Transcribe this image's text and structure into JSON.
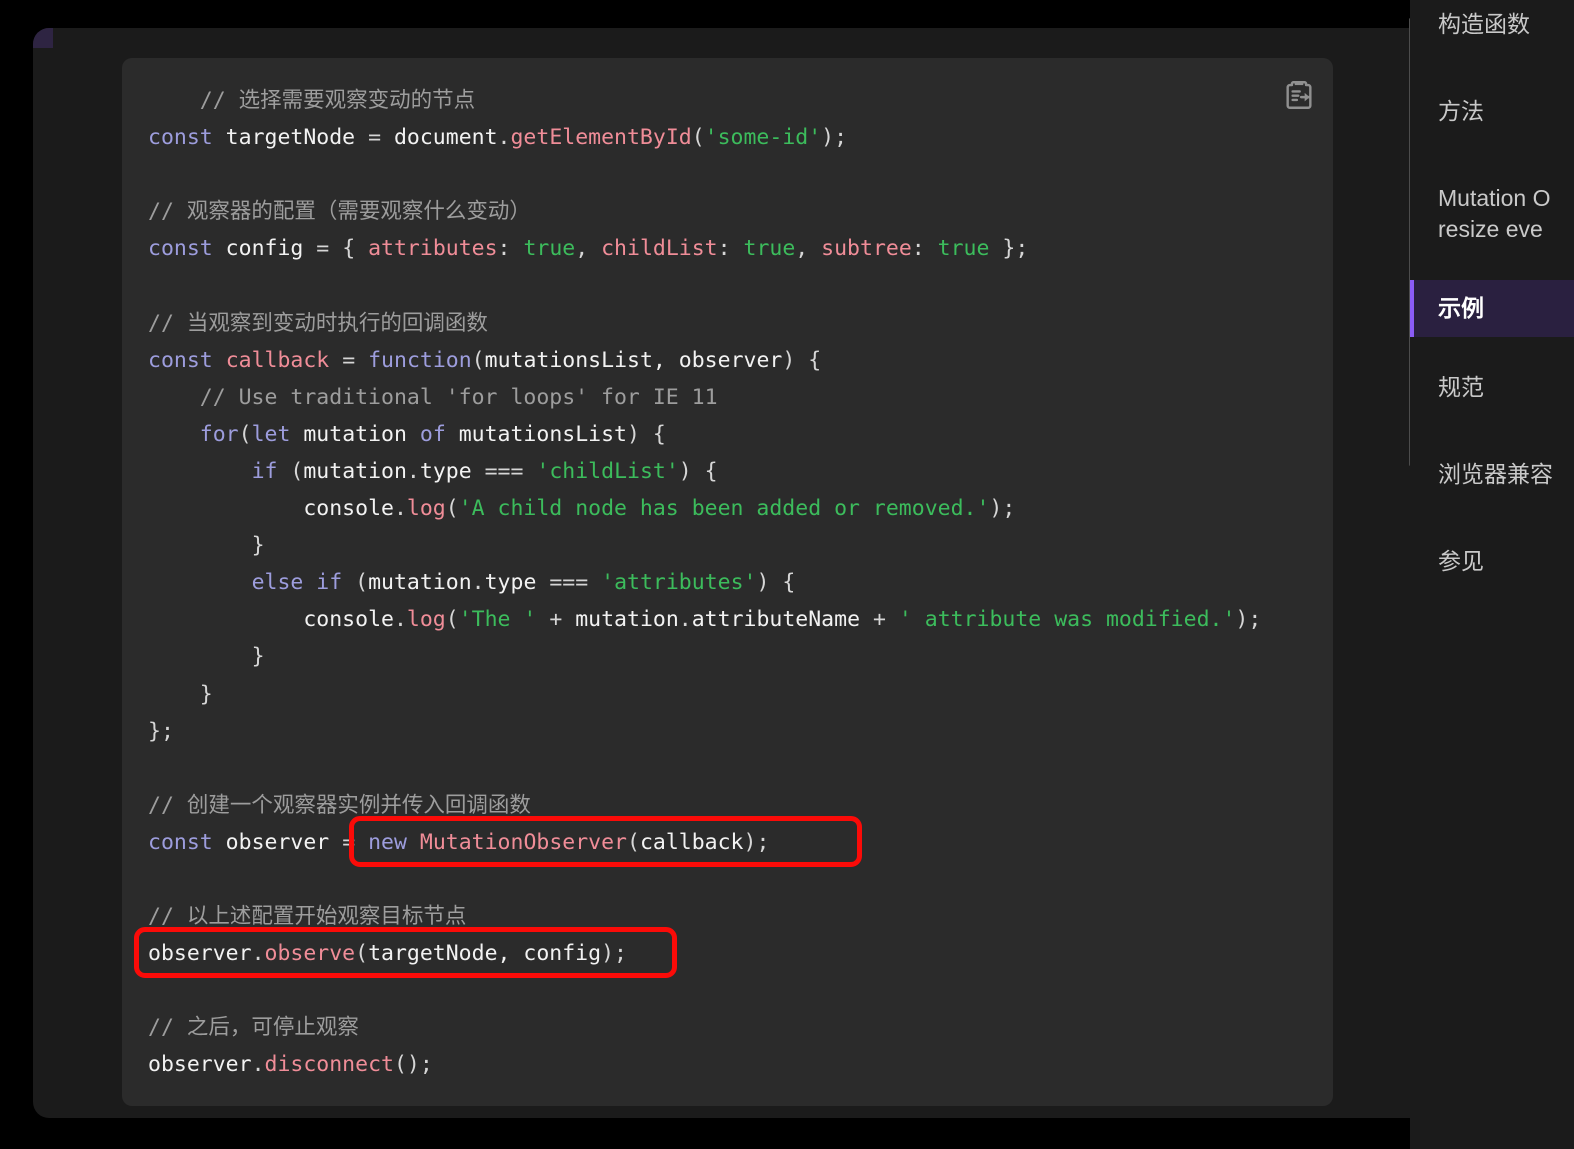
{
  "page": {
    "surface_color": "#1b1b1b",
    "corner_accent_color": "#2e2442"
  },
  "code_block": {
    "language": "javascript",
    "background_color": "#2b2b2b",
    "copy_icon": "clipboard-copy-icon",
    "lines": [
      {
        "indent": 1,
        "tokens": [
          {
            "t": "com",
            "s": "// 选择需要观察变动的节点"
          }
        ]
      },
      {
        "indent": 0,
        "tokens": [
          {
            "t": "kw",
            "s": "const"
          },
          {
            "t": "pln",
            "s": " targetNode "
          },
          {
            "t": "punc",
            "s": "="
          },
          {
            "t": "pln",
            "s": " document"
          },
          {
            "t": "punc",
            "s": "."
          },
          {
            "t": "fn",
            "s": "getElementById"
          },
          {
            "t": "punc",
            "s": "("
          },
          {
            "t": "str",
            "s": "'some-id'"
          },
          {
            "t": "punc",
            "s": ");"
          }
        ]
      },
      {
        "indent": 0,
        "tokens": []
      },
      {
        "indent": 0,
        "tokens": [
          {
            "t": "com",
            "s": "// 观察器的配置（需要观察什么变动）"
          }
        ]
      },
      {
        "indent": 0,
        "tokens": [
          {
            "t": "kw",
            "s": "const"
          },
          {
            "t": "pln",
            "s": " config "
          },
          {
            "t": "punc",
            "s": "="
          },
          {
            "t": "punc",
            "s": " { "
          },
          {
            "t": "fn",
            "s": "attributes"
          },
          {
            "t": "punc",
            "s": ": "
          },
          {
            "t": "num",
            "s": "true"
          },
          {
            "t": "punc",
            "s": ", "
          },
          {
            "t": "fn",
            "s": "childList"
          },
          {
            "t": "punc",
            "s": ": "
          },
          {
            "t": "num",
            "s": "true"
          },
          {
            "t": "punc",
            "s": ", "
          },
          {
            "t": "fn",
            "s": "subtree"
          },
          {
            "t": "punc",
            "s": ": "
          },
          {
            "t": "num",
            "s": "true"
          },
          {
            "t": "punc",
            "s": " };"
          }
        ]
      },
      {
        "indent": 0,
        "tokens": []
      },
      {
        "indent": 0,
        "tokens": [
          {
            "t": "com",
            "s": "// 当观察到变动时执行的回调函数"
          }
        ]
      },
      {
        "indent": 0,
        "tokens": [
          {
            "t": "kw",
            "s": "const"
          },
          {
            "t": "pln",
            "s": " "
          },
          {
            "t": "fn",
            "s": "callback"
          },
          {
            "t": "pln",
            "s": " "
          },
          {
            "t": "punc",
            "s": "="
          },
          {
            "t": "pln",
            "s": " "
          },
          {
            "t": "kw",
            "s": "function"
          },
          {
            "t": "punc",
            "s": "("
          },
          {
            "t": "pln",
            "s": "mutationsList, observer"
          },
          {
            "t": "punc",
            "s": ") {"
          }
        ]
      },
      {
        "indent": 1,
        "tokens": [
          {
            "t": "com",
            "s": "// Use traditional 'for loops' for IE 11"
          }
        ]
      },
      {
        "indent": 1,
        "tokens": [
          {
            "t": "kw",
            "s": "for"
          },
          {
            "t": "punc",
            "s": "("
          },
          {
            "t": "kw",
            "s": "let"
          },
          {
            "t": "pln",
            "s": " mutation "
          },
          {
            "t": "kw",
            "s": "of"
          },
          {
            "t": "pln",
            "s": " mutationsList"
          },
          {
            "t": "punc",
            "s": ") {"
          }
        ]
      },
      {
        "indent": 2,
        "tokens": [
          {
            "t": "kw",
            "s": "if"
          },
          {
            "t": "pln",
            "s": " "
          },
          {
            "t": "punc",
            "s": "("
          },
          {
            "t": "pln",
            "s": "mutation"
          },
          {
            "t": "punc",
            "s": "."
          },
          {
            "t": "pln",
            "s": "type "
          },
          {
            "t": "punc",
            "s": "==="
          },
          {
            "t": "pln",
            "s": " "
          },
          {
            "t": "str",
            "s": "'childList'"
          },
          {
            "t": "punc",
            "s": ") {"
          }
        ]
      },
      {
        "indent": 3,
        "tokens": [
          {
            "t": "pln",
            "s": "console"
          },
          {
            "t": "punc",
            "s": "."
          },
          {
            "t": "fn",
            "s": "log"
          },
          {
            "t": "punc",
            "s": "("
          },
          {
            "t": "str",
            "s": "'A child node has been added or removed.'"
          },
          {
            "t": "punc",
            "s": ");"
          }
        ]
      },
      {
        "indent": 2,
        "tokens": [
          {
            "t": "punc",
            "s": "}"
          }
        ]
      },
      {
        "indent": 2,
        "tokens": [
          {
            "t": "kw",
            "s": "else"
          },
          {
            "t": "pln",
            "s": " "
          },
          {
            "t": "kw",
            "s": "if"
          },
          {
            "t": "pln",
            "s": " "
          },
          {
            "t": "punc",
            "s": "("
          },
          {
            "t": "pln",
            "s": "mutation"
          },
          {
            "t": "punc",
            "s": "."
          },
          {
            "t": "pln",
            "s": "type "
          },
          {
            "t": "punc",
            "s": "==="
          },
          {
            "t": "pln",
            "s": " "
          },
          {
            "t": "str",
            "s": "'attributes'"
          },
          {
            "t": "punc",
            "s": ") {"
          }
        ]
      },
      {
        "indent": 3,
        "tokens": [
          {
            "t": "pln",
            "s": "console"
          },
          {
            "t": "punc",
            "s": "."
          },
          {
            "t": "fn",
            "s": "log"
          },
          {
            "t": "punc",
            "s": "("
          },
          {
            "t": "str",
            "s": "'The '"
          },
          {
            "t": "pln",
            "s": " "
          },
          {
            "t": "punc",
            "s": "+"
          },
          {
            "t": "pln",
            "s": " mutation"
          },
          {
            "t": "punc",
            "s": "."
          },
          {
            "t": "pln",
            "s": "attributeName "
          },
          {
            "t": "punc",
            "s": "+"
          },
          {
            "t": "pln",
            "s": " "
          },
          {
            "t": "str",
            "s": "' attribute was modified.'"
          },
          {
            "t": "punc",
            "s": ");"
          }
        ]
      },
      {
        "indent": 2,
        "tokens": [
          {
            "t": "punc",
            "s": "}"
          }
        ]
      },
      {
        "indent": 1,
        "tokens": [
          {
            "t": "punc",
            "s": "}"
          }
        ]
      },
      {
        "indent": 0,
        "tokens": [
          {
            "t": "punc",
            "s": "};"
          }
        ]
      },
      {
        "indent": 0,
        "tokens": []
      },
      {
        "indent": 0,
        "tokens": [
          {
            "t": "com",
            "s": "// 创建一个观察器实例并传入回调函数"
          }
        ]
      },
      {
        "indent": 0,
        "tokens": [
          {
            "t": "kw",
            "s": "const"
          },
          {
            "t": "pln",
            "s": " observer "
          },
          {
            "t": "punc",
            "s": "="
          },
          {
            "t": "pln",
            "s": " "
          },
          {
            "t": "kw",
            "s": "new"
          },
          {
            "t": "pln",
            "s": " "
          },
          {
            "t": "fn",
            "s": "MutationObserver"
          },
          {
            "t": "punc",
            "s": "("
          },
          {
            "t": "pln",
            "s": "callback"
          },
          {
            "t": "punc",
            "s": ");"
          }
        ]
      },
      {
        "indent": 0,
        "tokens": []
      },
      {
        "indent": 0,
        "tokens": [
          {
            "t": "com",
            "s": "// 以上述配置开始观察目标节点"
          }
        ]
      },
      {
        "indent": 0,
        "tokens": [
          {
            "t": "pln",
            "s": "observer"
          },
          {
            "t": "punc",
            "s": "."
          },
          {
            "t": "fn",
            "s": "observe"
          },
          {
            "t": "punc",
            "s": "("
          },
          {
            "t": "pln",
            "s": "targetNode, config"
          },
          {
            "t": "punc",
            "s": ");"
          }
        ]
      },
      {
        "indent": 0,
        "tokens": []
      },
      {
        "indent": 0,
        "tokens": [
          {
            "t": "com",
            "s": "// 之后，可停止观察"
          }
        ]
      },
      {
        "indent": 0,
        "tokens": [
          {
            "t": "pln",
            "s": "observer"
          },
          {
            "t": "punc",
            "s": "."
          },
          {
            "t": "fn",
            "s": "disconnect"
          },
          {
            "t": "punc",
            "s": "();"
          }
        ]
      }
    ]
  },
  "annotations": {
    "color": "#fb0b08",
    "boxes": [
      {
        "label": "new MutationObserver(callback);"
      },
      {
        "label": "observer.observe(targetNode, config);"
      }
    ]
  },
  "toc": {
    "active_color": "#8b5cf6",
    "active_background": "#2a2040",
    "items": [
      {
        "label": "构造函数",
        "active": false,
        "clipped": true
      },
      {
        "label": "方法",
        "active": false,
        "clipped": false
      },
      {
        "label": "Mutation O\nresize eve",
        "active": false,
        "clipped": true
      },
      {
        "label": "示例",
        "active": true,
        "clipped": false
      },
      {
        "label": "规范",
        "active": false,
        "clipped": false
      },
      {
        "label": "浏览器兼容",
        "active": false,
        "clipped": true
      },
      {
        "label": "参见",
        "active": false,
        "clipped": false
      }
    ]
  }
}
